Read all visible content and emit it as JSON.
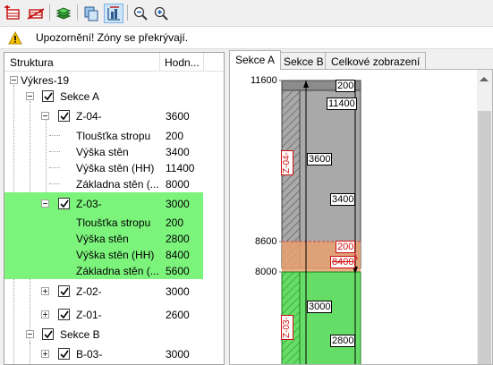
{
  "toolbar": {
    "buttons": [
      {
        "name": "add-zone-icon"
      },
      {
        "name": "delete-zone-icon"
      },
      {
        "name": "layers-icon"
      },
      {
        "name": "copy-icon"
      },
      {
        "name": "section-view-icon"
      },
      {
        "name": "zoom-out-icon"
      },
      {
        "name": "zoom-in-icon"
      }
    ]
  },
  "warning": {
    "text": "Upozornění! Zóny se překrývají."
  },
  "tree": {
    "col_structure": "Struktura",
    "col_value": "Hodn...",
    "rows": [
      {
        "label": "Výkres-19",
        "value": ""
      },
      {
        "label": "Sekce A",
        "value": ""
      },
      {
        "label": "Z-04-",
        "value": "3600"
      },
      {
        "label": "Tloušťka stropu",
        "value": "200"
      },
      {
        "label": "Výška stěn",
        "value": "3400"
      },
      {
        "label": "Výška stěn (HH)",
        "value": "11400"
      },
      {
        "label": "Základna stěn (...",
        "value": "8000"
      },
      {
        "label": "Z-03-",
        "value": "3000"
      },
      {
        "label": "Tloušťka stropu",
        "value": "200"
      },
      {
        "label": "Výška stěn",
        "value": "2800"
      },
      {
        "label": "Výška stěn (HH)",
        "value": "8400"
      },
      {
        "label": "Základna stěn (...",
        "value": "5600"
      },
      {
        "label": "Z-02-",
        "value": "3000"
      },
      {
        "label": "Z-01-",
        "value": "2600"
      },
      {
        "label": "Sekce B",
        "value": ""
      },
      {
        "label": "B-03-",
        "value": "3000"
      }
    ]
  },
  "tabs": [
    {
      "label": "Sekce A",
      "active": true
    },
    {
      "label": "Sekce B",
      "active": false
    },
    {
      "label": "Celkové zobrazení",
      "active": false
    }
  ],
  "section_view": {
    "elevations": [
      "11600",
      "8600",
      "8000"
    ],
    "zone_labels": [
      "Z-04-",
      "Z-03-"
    ],
    "dimensions": [
      "200",
      "11400",
      "3600",
      "3400",
      "200",
      "8400",
      "3000",
      "2800"
    ]
  },
  "colors": {
    "selection": "#7cf47c",
    "zone_upper": "#a9a9a9",
    "zone_lower": "#66dd66",
    "overlap": "#e8a070",
    "warning": "#f5c400"
  }
}
